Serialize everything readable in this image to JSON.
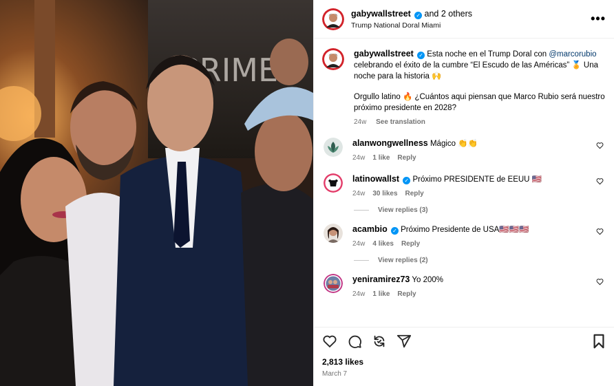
{
  "post": {
    "author": "gabywallstreet",
    "and_others": "and 2 others",
    "location": "Trump National Doral Miami",
    "more_label": "•••"
  },
  "caption": {
    "author": "gabywallstreet",
    "text1": "Esta noche en el Trump Doral con",
    "mention": "@marcorubio",
    "text2": "celebrando el éxito de la cumbre “El Escudo de las Américas” 🏅 Una noche para la historia 🙌",
    "text3": "Orgullo latino 🔥 ¿Cuántos aqui piensan que Marco Rubio será nuestro próximo presidente en 2028?",
    "age": "24w",
    "translate": "See translation"
  },
  "comments": [
    {
      "user": "alanwongwellness",
      "verified": false,
      "text": "Mágico 👏👏",
      "age": "24w",
      "likes": "1 like",
      "reply": "Reply",
      "replies": ""
    },
    {
      "user": "latinowallst",
      "verified": true,
      "text": "Próximo PRESIDENTE de EEUU 🇺🇸",
      "age": "24w",
      "likes": "30 likes",
      "reply": "Reply",
      "replies": "View replies (3)"
    },
    {
      "user": "acambio",
      "verified": true,
      "text": "Próximo Presidente de USA🇺🇸🇺🇸🇺🇸",
      "age": "24w",
      "likes": "4 likes",
      "reply": "Reply",
      "replies": "View replies (2)"
    },
    {
      "user": "yeniramirez73",
      "verified": false,
      "text": "Yo 200%",
      "age": "24w",
      "likes": "1 like",
      "reply": "Reply",
      "replies": ""
    }
  ],
  "footer": {
    "likes": "2,813 likes",
    "date": "March 7"
  },
  "photo": {
    "sign_text": "PRIME"
  },
  "icons": [
    "heart-icon",
    "comment-icon",
    "repost-icon",
    "share-icon",
    "bookmark-icon",
    "verified-icon",
    "more-icon"
  ],
  "colors": {
    "verified": "#0095f6",
    "mention": "#00376b",
    "muted": "#737373"
  }
}
